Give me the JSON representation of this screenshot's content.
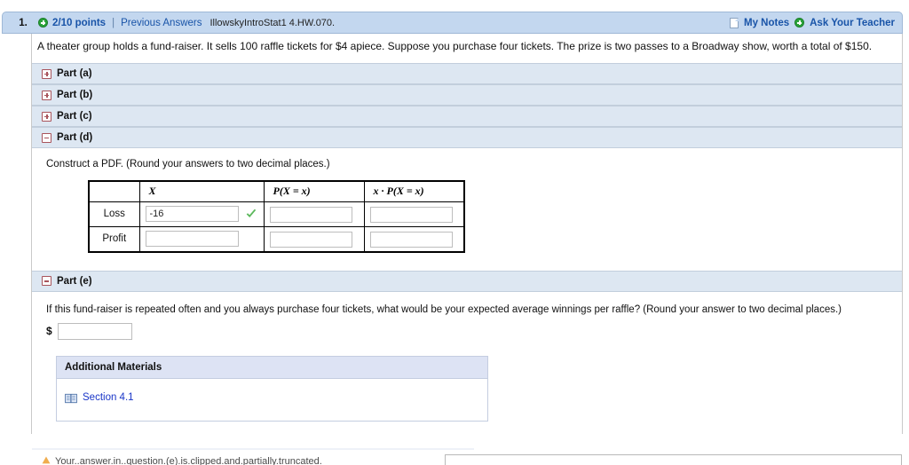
{
  "header": {
    "question_number": "1.",
    "points": "2/10 points",
    "separator": "|",
    "previous_answers": "Previous Answers",
    "question_ref": "IllowskyIntroStat1 4.HW.070.",
    "my_notes": "My Notes",
    "ask_your_teacher": "Ask Your Teacher",
    "plus_icon": "plus-circle-icon",
    "note_icon": "note-page-icon"
  },
  "question": {
    "stem": "A theater group holds a fund-raiser. It sells 100 raffle tickets for $4 apiece. Suppose you purchase four tickets. The prize is two passes to a Broadway show, worth a total of $150."
  },
  "parts": [
    {
      "label": "Part (a)",
      "state": "collapsed",
      "icon": "plus-box-icon"
    },
    {
      "label": "Part (b)",
      "state": "collapsed",
      "icon": "plus-box-icon"
    },
    {
      "label": "Part (c)",
      "state": "collapsed",
      "icon": "plus-box-icon"
    },
    {
      "label": "Part (d)",
      "state": "expanded",
      "icon": "minus-box-icon"
    },
    {
      "label": "Part (e)",
      "state": "expanded",
      "icon": "minus-box-icon"
    }
  ],
  "part_d": {
    "prompt": "Construct a PDF. (Round your answers to two decimal places.)",
    "table": {
      "headers": [
        "",
        "X",
        "P(X = x)",
        "x · P(X = x)"
      ],
      "rows": [
        {
          "label": "Loss",
          "x_value": "-16",
          "x_status": "correct",
          "p_value": "",
          "xp_value": ""
        },
        {
          "label": "Profit",
          "x_value": "",
          "x_status": "none",
          "p_value": "",
          "xp_value": ""
        }
      ]
    },
    "check_icon": "green-check-icon"
  },
  "part_e": {
    "prompt": "If this fund-raiser is repeated often and you always purchase four tickets, what would be your expected average winnings per raffle? (Round your answer to two decimal places.)",
    "currency_symbol": "$",
    "answer_value": ""
  },
  "additional_materials": {
    "title": "Additional Materials",
    "items": [
      {
        "label": "Section 4.1",
        "icon": "book-icon"
      }
    ]
  },
  "footer": {
    "note": "Your..answer.in..question.(e).is.clipped.and.partially.truncated.",
    "warn_icon": "warning-icon"
  },
  "colors": {
    "header_bg": "#c3d7ef",
    "part_bar_bg": "#dde7f2",
    "link_blue": "#1954a8",
    "section_link_blue": "#1a36c8",
    "check_green": "#5cb85c",
    "toggle_red": "#a8545c",
    "addmat_head_bg": "#dde3f4"
  }
}
